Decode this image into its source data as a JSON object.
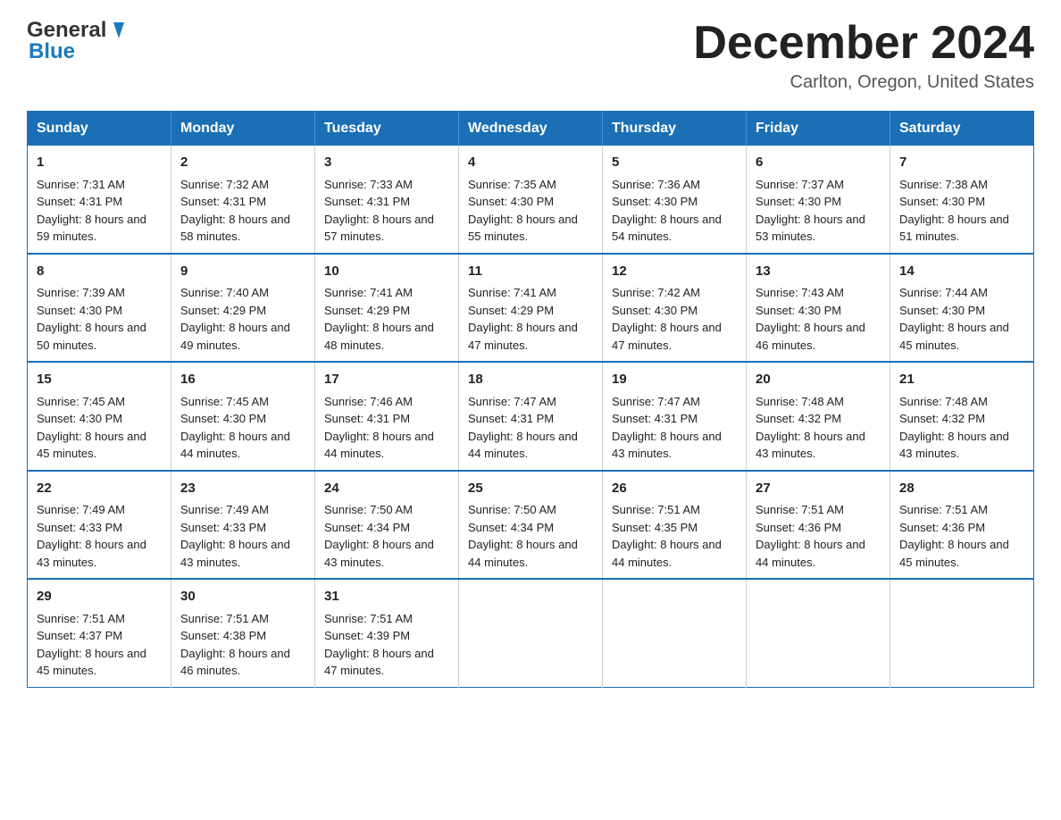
{
  "header": {
    "title": "December 2024",
    "location": "Carlton, Oregon, United States",
    "logo_general": "General",
    "logo_blue": "Blue"
  },
  "days_of_week": [
    "Sunday",
    "Monday",
    "Tuesday",
    "Wednesday",
    "Thursday",
    "Friday",
    "Saturday"
  ],
  "weeks": [
    [
      {
        "day": "1",
        "sunrise": "7:31 AM",
        "sunset": "4:31 PM",
        "daylight": "8 hours and 59 minutes."
      },
      {
        "day": "2",
        "sunrise": "7:32 AM",
        "sunset": "4:31 PM",
        "daylight": "8 hours and 58 minutes."
      },
      {
        "day": "3",
        "sunrise": "7:33 AM",
        "sunset": "4:31 PM",
        "daylight": "8 hours and 57 minutes."
      },
      {
        "day": "4",
        "sunrise": "7:35 AM",
        "sunset": "4:30 PM",
        "daylight": "8 hours and 55 minutes."
      },
      {
        "day": "5",
        "sunrise": "7:36 AM",
        "sunset": "4:30 PM",
        "daylight": "8 hours and 54 minutes."
      },
      {
        "day": "6",
        "sunrise": "7:37 AM",
        "sunset": "4:30 PM",
        "daylight": "8 hours and 53 minutes."
      },
      {
        "day": "7",
        "sunrise": "7:38 AM",
        "sunset": "4:30 PM",
        "daylight": "8 hours and 51 minutes."
      }
    ],
    [
      {
        "day": "8",
        "sunrise": "7:39 AM",
        "sunset": "4:30 PM",
        "daylight": "8 hours and 50 minutes."
      },
      {
        "day": "9",
        "sunrise": "7:40 AM",
        "sunset": "4:29 PM",
        "daylight": "8 hours and 49 minutes."
      },
      {
        "day": "10",
        "sunrise": "7:41 AM",
        "sunset": "4:29 PM",
        "daylight": "8 hours and 48 minutes."
      },
      {
        "day": "11",
        "sunrise": "7:41 AM",
        "sunset": "4:29 PM",
        "daylight": "8 hours and 47 minutes."
      },
      {
        "day": "12",
        "sunrise": "7:42 AM",
        "sunset": "4:30 PM",
        "daylight": "8 hours and 47 minutes."
      },
      {
        "day": "13",
        "sunrise": "7:43 AM",
        "sunset": "4:30 PM",
        "daylight": "8 hours and 46 minutes."
      },
      {
        "day": "14",
        "sunrise": "7:44 AM",
        "sunset": "4:30 PM",
        "daylight": "8 hours and 45 minutes."
      }
    ],
    [
      {
        "day": "15",
        "sunrise": "7:45 AM",
        "sunset": "4:30 PM",
        "daylight": "8 hours and 45 minutes."
      },
      {
        "day": "16",
        "sunrise": "7:45 AM",
        "sunset": "4:30 PM",
        "daylight": "8 hours and 44 minutes."
      },
      {
        "day": "17",
        "sunrise": "7:46 AM",
        "sunset": "4:31 PM",
        "daylight": "8 hours and 44 minutes."
      },
      {
        "day": "18",
        "sunrise": "7:47 AM",
        "sunset": "4:31 PM",
        "daylight": "8 hours and 44 minutes."
      },
      {
        "day": "19",
        "sunrise": "7:47 AM",
        "sunset": "4:31 PM",
        "daylight": "8 hours and 43 minutes."
      },
      {
        "day": "20",
        "sunrise": "7:48 AM",
        "sunset": "4:32 PM",
        "daylight": "8 hours and 43 minutes."
      },
      {
        "day": "21",
        "sunrise": "7:48 AM",
        "sunset": "4:32 PM",
        "daylight": "8 hours and 43 minutes."
      }
    ],
    [
      {
        "day": "22",
        "sunrise": "7:49 AM",
        "sunset": "4:33 PM",
        "daylight": "8 hours and 43 minutes."
      },
      {
        "day": "23",
        "sunrise": "7:49 AM",
        "sunset": "4:33 PM",
        "daylight": "8 hours and 43 minutes."
      },
      {
        "day": "24",
        "sunrise": "7:50 AM",
        "sunset": "4:34 PM",
        "daylight": "8 hours and 43 minutes."
      },
      {
        "day": "25",
        "sunrise": "7:50 AM",
        "sunset": "4:34 PM",
        "daylight": "8 hours and 44 minutes."
      },
      {
        "day": "26",
        "sunrise": "7:51 AM",
        "sunset": "4:35 PM",
        "daylight": "8 hours and 44 minutes."
      },
      {
        "day": "27",
        "sunrise": "7:51 AM",
        "sunset": "4:36 PM",
        "daylight": "8 hours and 44 minutes."
      },
      {
        "day": "28",
        "sunrise": "7:51 AM",
        "sunset": "4:36 PM",
        "daylight": "8 hours and 45 minutes."
      }
    ],
    [
      {
        "day": "29",
        "sunrise": "7:51 AM",
        "sunset": "4:37 PM",
        "daylight": "8 hours and 45 minutes."
      },
      {
        "day": "30",
        "sunrise": "7:51 AM",
        "sunset": "4:38 PM",
        "daylight": "8 hours and 46 minutes."
      },
      {
        "day": "31",
        "sunrise": "7:51 AM",
        "sunset": "4:39 PM",
        "daylight": "8 hours and 47 minutes."
      },
      null,
      null,
      null,
      null
    ]
  ]
}
